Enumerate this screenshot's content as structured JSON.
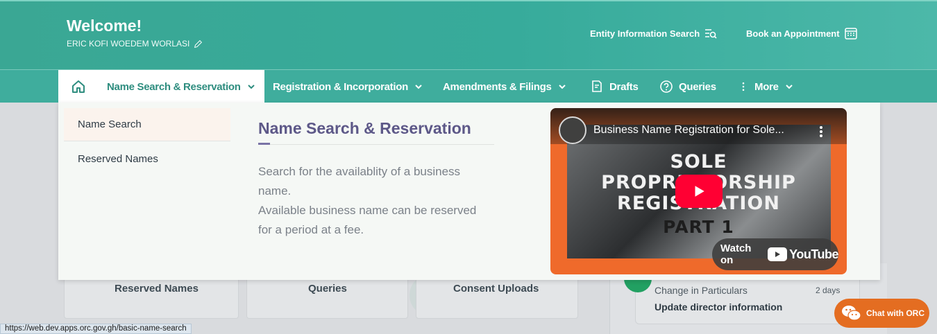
{
  "header": {
    "welcome": "Welcome!",
    "username": "ERIC KOFI WOEDEM WORLASI",
    "entity_search": "Entity Information Search",
    "book_appointment": "Book an Appointment"
  },
  "nav": {
    "items": [
      {
        "label": "Name Search & Reservation"
      },
      {
        "label": "Registration & Incorporation"
      },
      {
        "label": "Amendments & Filings"
      },
      {
        "label": "Drafts"
      },
      {
        "label": "Queries"
      },
      {
        "label": "More"
      }
    ]
  },
  "mega_menu": {
    "submenu": [
      "Name Search",
      "Reserved Names"
    ],
    "title": "Name Search & Reservation",
    "description_lines": [
      "Search for the availablity of a business",
      "name.",
      "Available business name can be reserved",
      "for a period at a fee."
    ],
    "video": {
      "title": "Business Name Registration for Sole...",
      "thumb_lines": [
        "SOLE",
        "PROPRIETORSHIP",
        "REGISTRATION",
        "PART 1"
      ],
      "watch_on": "Watch on",
      "youtube": "YouTube"
    }
  },
  "dashboard": {
    "cards": [
      "Reserved Names",
      "Queries",
      "Consent Uploads"
    ],
    "activity": {
      "type": "Change in Particulars",
      "time": "2 days",
      "title": "Update director information"
    }
  },
  "status_url": "https://web.dev.apps.orc.gov.gh/basic-name-search",
  "chat_label": "Chat with ORC",
  "colors": {
    "header": "#3aa794",
    "accent_text": "#2e8d7f",
    "title_purple": "#5d5888",
    "chat_orange": "#e46d21"
  }
}
